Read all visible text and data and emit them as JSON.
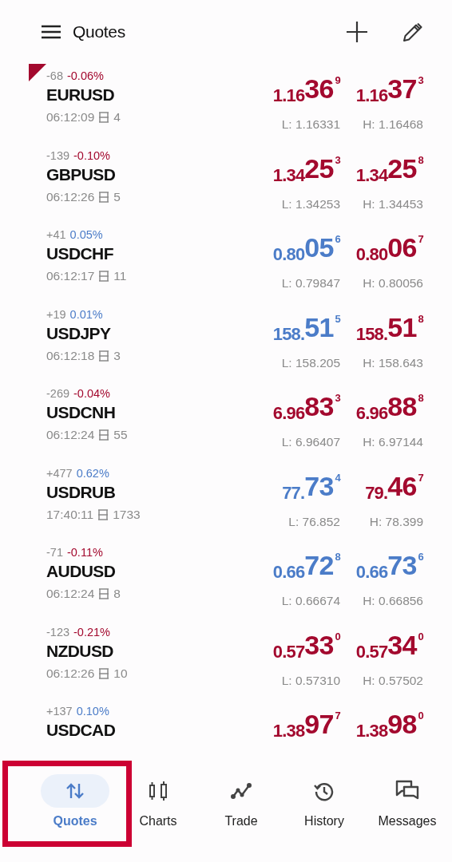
{
  "header": {
    "title": "Quotes"
  },
  "quotes": [
    {
      "flagged": true,
      "change_points": "-68",
      "change_percent": {
        "text": "-0.06%",
        "color": "#a3092e"
      },
      "symbol": "EURUSD",
      "time": "06:12:09",
      "spread": "4",
      "bid": {
        "prefix": "1.16",
        "big": "36",
        "pip": "9",
        "color": "#a3092e"
      },
      "ask": {
        "prefix": "1.16",
        "big": "37",
        "pip": "3",
        "color": "#a3092e"
      },
      "low": "L: 1.16331",
      "high": "H: 1.16468"
    },
    {
      "flagged": false,
      "change_points": "-139",
      "change_percent": {
        "text": "-0.10%",
        "color": "#a3092e"
      },
      "symbol": "GBPUSD",
      "time": "06:12:26",
      "spread": "5",
      "bid": {
        "prefix": "1.34",
        "big": "25",
        "pip": "3",
        "color": "#a3092e"
      },
      "ask": {
        "prefix": "1.34",
        "big": "25",
        "pip": "8",
        "color": "#a3092e"
      },
      "low": "L: 1.34253",
      "high": "H: 1.34453"
    },
    {
      "flagged": false,
      "change_points": "+41",
      "change_percent": {
        "text": "0.05%",
        "color": "#4b7cc8"
      },
      "symbol": "USDCHF",
      "time": "06:12:17",
      "spread": "11",
      "bid": {
        "prefix": "0.80",
        "big": "05",
        "pip": "6",
        "color": "#4b7cc8"
      },
      "ask": {
        "prefix": "0.80",
        "big": "06",
        "pip": "7",
        "color": "#a3092e"
      },
      "low": "L: 0.79847",
      "high": "H: 0.80056"
    },
    {
      "flagged": false,
      "change_points": "+19",
      "change_percent": {
        "text": "0.01%",
        "color": "#4b7cc8"
      },
      "symbol": "USDJPY",
      "time": "06:12:18",
      "spread": "3",
      "bid": {
        "prefix": "158.",
        "big": "51",
        "pip": "5",
        "color": "#4b7cc8"
      },
      "ask": {
        "prefix": "158.",
        "big": "51",
        "pip": "8",
        "color": "#a3092e"
      },
      "low": "L: 158.205",
      "high": "H: 158.643"
    },
    {
      "flagged": false,
      "change_points": "-269",
      "change_percent": {
        "text": "-0.04%",
        "color": "#a3092e"
      },
      "symbol": "USDCNH",
      "time": "06:12:24",
      "spread": "55",
      "bid": {
        "prefix": "6.96",
        "big": "83",
        "pip": "3",
        "color": "#a3092e"
      },
      "ask": {
        "prefix": "6.96",
        "big": "88",
        "pip": "8",
        "color": "#a3092e"
      },
      "low": "L: 6.96407",
      "high": "H: 6.97144"
    },
    {
      "flagged": false,
      "change_points": "+477",
      "change_percent": {
        "text": "0.62%",
        "color": "#4b7cc8"
      },
      "symbol": "USDRUB",
      "time": "17:40:11",
      "spread": "1733",
      "bid": {
        "prefix": "77.",
        "big": "73",
        "pip": "4",
        "color": "#4b7cc8"
      },
      "ask": {
        "prefix": "79.",
        "big": "46",
        "pip": "7",
        "color": "#a3092e"
      },
      "low": "L: 76.852",
      "high": "H: 78.399"
    },
    {
      "flagged": false,
      "change_points": "-71",
      "change_percent": {
        "text": "-0.11%",
        "color": "#a3092e"
      },
      "symbol": "AUDUSD",
      "time": "06:12:24",
      "spread": "8",
      "bid": {
        "prefix": "0.66",
        "big": "72",
        "pip": "8",
        "color": "#4b7cc8"
      },
      "ask": {
        "prefix": "0.66",
        "big": "73",
        "pip": "6",
        "color": "#4b7cc8"
      },
      "low": "L: 0.66674",
      "high": "H: 0.66856"
    },
    {
      "flagged": false,
      "change_points": "-123",
      "change_percent": {
        "text": "-0.21%",
        "color": "#a3092e"
      },
      "symbol": "NZDUSD",
      "time": "06:12:26",
      "spread": "10",
      "bid": {
        "prefix": "0.57",
        "big": "33",
        "pip": "0",
        "color": "#a3092e"
      },
      "ask": {
        "prefix": "0.57",
        "big": "34",
        "pip": "0",
        "color": "#a3092e"
      },
      "low": "L: 0.57310",
      "high": "H: 0.57502"
    },
    {
      "flagged": false,
      "change_points": "+137",
      "change_percent": {
        "text": "0.10%",
        "color": "#4b7cc8"
      },
      "symbol": "USDCAD",
      "bid": {
        "prefix": "1.38",
        "big": "97",
        "pip": "7",
        "color": "#a3092e"
      },
      "ask": {
        "prefix": "1.38",
        "big": "98",
        "pip": "0",
        "color": "#a3092e"
      }
    }
  ],
  "bottom_nav": [
    {
      "kind": "quotes",
      "label": "Quotes",
      "selected": true,
      "highlighted": true
    },
    {
      "kind": "charts",
      "label": "Charts",
      "selected": false,
      "highlighted": false
    },
    {
      "kind": "trade",
      "label": "Trade",
      "selected": false,
      "highlighted": false
    },
    {
      "kind": "history",
      "label": "History",
      "selected": false,
      "highlighted": false
    },
    {
      "kind": "messages",
      "label": "Messages",
      "selected": false,
      "highlighted": false
    }
  ]
}
